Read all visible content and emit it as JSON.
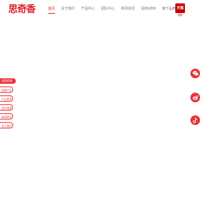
{
  "header": {
    "logo_text": "思奇香",
    "nav": [
      {
        "label": "首页"
      },
      {
        "label": "关于我们"
      },
      {
        "label": "产品中心"
      },
      {
        "label": "团队中心"
      },
      {
        "label": "新闻资讯"
      },
      {
        "label": "招商OEM"
      },
      {
        "label": "旗下品牌"
      }
    ],
    "tmall": {
      "badge": "天猫",
      "caption": "旗舰"
    }
  },
  "side_menu": {
    "title": "思奇招商",
    "items": [
      {
        "label": "招商产品"
      },
      {
        "label": "产品系列"
      },
      {
        "label": "合作流程"
      },
      {
        "label": "新闻资讯"
      },
      {
        "label": "关于我们"
      }
    ]
  },
  "social": {
    "icons": [
      "wechat-icon",
      "weibo-icon",
      "tiktok-icon"
    ]
  },
  "colors": {
    "accent": "#e8343a",
    "brand": "#d9262b",
    "nav_text": "#777777",
    "tmall": "#c40000"
  }
}
